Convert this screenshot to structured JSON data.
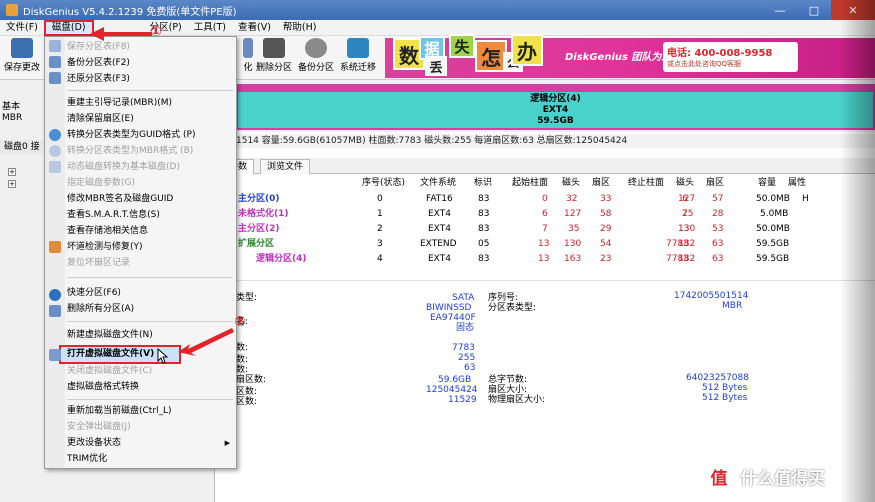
{
  "window": {
    "title": "DiskGenius V5.4.2.1239 免费版(单文件PE版)",
    "controls": [
      "—",
      "□",
      "✕"
    ]
  },
  "menubar": {
    "items": [
      "文件(F)",
      "磁盘(D)",
      "分区(P)",
      "工具(T)",
      "查看(V)",
      "帮助(H)"
    ]
  },
  "toolbar": {
    "save_label": "保存更改",
    "visible_labels": [
      "化",
      "删除分区",
      "备份分区",
      "系统迁移"
    ]
  },
  "banner": {
    "tiles": [
      "数",
      "据",
      "丢",
      "失",
      "怎",
      "么",
      "办"
    ],
    "slogan": "DiskGenius 团队为您服务",
    "phone": "电话: 400-008-9958",
    "qq": "或点击此处咨询QQ客服"
  },
  "leftpanel": {
    "disk_type_lines": [
      "基本",
      "MBR"
    ],
    "header": "磁盘0 接"
  },
  "partition_bar": {
    "name": "逻辑分区(4)",
    "fs": "EXT4",
    "size": "59.5GB"
  },
  "disk_info_line": "1514  容量:59.6GB(61057MB)  柱面数:7783  磁头数:255  每道扇区数:63  总扇区数:125045424",
  "tabs": [
    "参数",
    "浏览文件"
  ],
  "partition_table": {
    "headers": [
      "序号(状态)",
      "文件系统",
      "标识",
      "起始柱面",
      "磁头",
      "扇区",
      "终止柱面",
      "磁头",
      "扇区",
      "容量",
      "属性"
    ],
    "rows": [
      {
        "name": "主分区(0)",
        "index": "0",
        "fs": "FAT16",
        "id": "83",
        "sc": "0",
        "sh": "32",
        "ss": "33",
        "ec": "6",
        "eh": "127",
        "es": "57",
        "size": "50.0MB",
        "attr": "H"
      },
      {
        "name": "未格式化(1)",
        "index": "1",
        "fs": "EXT4",
        "id": "83",
        "sc": "6",
        "sh": "127",
        "ss": "58",
        "ec": "7",
        "eh": "25",
        "es": "28",
        "size": "5.0MB",
        "attr": ""
      },
      {
        "name": "主分区(2)",
        "index": "2",
        "fs": "EXT4",
        "id": "83",
        "sc": "7",
        "sh": "35",
        "ss": "29",
        "ec": "13",
        "eh": "130",
        "es": "53",
        "size": "50.0MB",
        "attr": ""
      },
      {
        "name": "扩展分区",
        "index": "3",
        "fs": "EXTEND",
        "id": "05",
        "sc": "13",
        "sh": "130",
        "ss": "54",
        "ec": "7783",
        "eh": "182",
        "es": "63",
        "size": "59.5GB",
        "attr": ""
      },
      {
        "name": "逻辑分区(4)",
        "index": "4",
        "fs": "EXT4",
        "id": "83",
        "sc": "13",
        "sh": "163",
        "ss": "23",
        "ec": "7783",
        "eh": "182",
        "es": "63",
        "size": "59.5GB",
        "attr": ""
      }
    ]
  },
  "details": {
    "left_labels": [
      "类型:",
      "",
      "名:",
      "",
      "数:",
      "数:",
      "数:",
      "扇区数:",
      "区数:",
      "区数:"
    ],
    "left_values": [
      "SATA",
      "BIWINSSD",
      "EA97440F",
      "固态",
      "7783",
      "255",
      "63",
      "59.6GB",
      "125045424",
      "11529"
    ],
    "right_labels": [
      "序列号:",
      "分区表类型:",
      "总字节数:",
      "扇区大小:",
      "物理扇区大小:"
    ],
    "right_values": [
      "1742005501514",
      "MBR",
      "64023257088",
      "512 Bytes",
      "512 Bytes"
    ]
  },
  "dropdown": {
    "items": [
      {
        "label": "保存分区表(F8)",
        "disabled": true
      },
      {
        "label": "备份分区表(F2)",
        "disabled": false
      },
      {
        "label": "还原分区表(F3)",
        "disabled": false
      },
      {
        "label": "重建主引导记录(MBR)(M)",
        "disabled": false
      },
      {
        "label": "清除保留扇区(E)",
        "disabled": false
      },
      {
        "label": "转换分区表类型为GUID格式 (P)",
        "disabled": false
      },
      {
        "label": "转换分区表类型为MBR格式 (B)",
        "disabled": true
      },
      {
        "label": "动态磁盘转换为基本磁盘(D)",
        "disabled": true
      },
      {
        "label": "指定磁盘参数(G)",
        "disabled": true
      },
      {
        "label": "修改MBR签名及磁盘GUID",
        "disabled": false
      },
      {
        "label": "查看S.M.A.R.T.信息(S)",
        "disabled": false
      },
      {
        "label": "查看存储池相关信息",
        "disabled": false
      },
      {
        "label": "坏道检测与修复(Y)",
        "disabled": false
      },
      {
        "label": "复位坏扇区记录",
        "disabled": true
      },
      {
        "label": "快速分区(F6)",
        "disabled": false
      },
      {
        "label": "删除所有分区(A)",
        "disabled": false
      },
      {
        "label": "新建虚拟磁盘文件(N)",
        "disabled": false
      },
      {
        "label": "打开虚拟磁盘文件(V)",
        "disabled": false
      },
      {
        "label": "关闭虚拟磁盘文件(C)",
        "disabled": true
      },
      {
        "label": "虚拟磁盘格式转换",
        "disabled": false
      },
      {
        "label": "重新加载当前磁盘(Ctrl_L)",
        "disabled": false
      },
      {
        "label": "安全弹出磁盘(J)",
        "disabled": true
      },
      {
        "label": "更改设备状态",
        "disabled": false
      },
      {
        "label": "TRIM优化",
        "disabled": false
      }
    ]
  },
  "annotations": {
    "step1": "①",
    "step2": "②"
  },
  "watermark": {
    "badge": "值",
    "text": "什么值得买"
  },
  "colors": {
    "accent_red": "#e0242a",
    "partition_cyan": "#49d2cc",
    "partition_magenta": "#d240a3",
    "value_blue": "#2040d0"
  }
}
